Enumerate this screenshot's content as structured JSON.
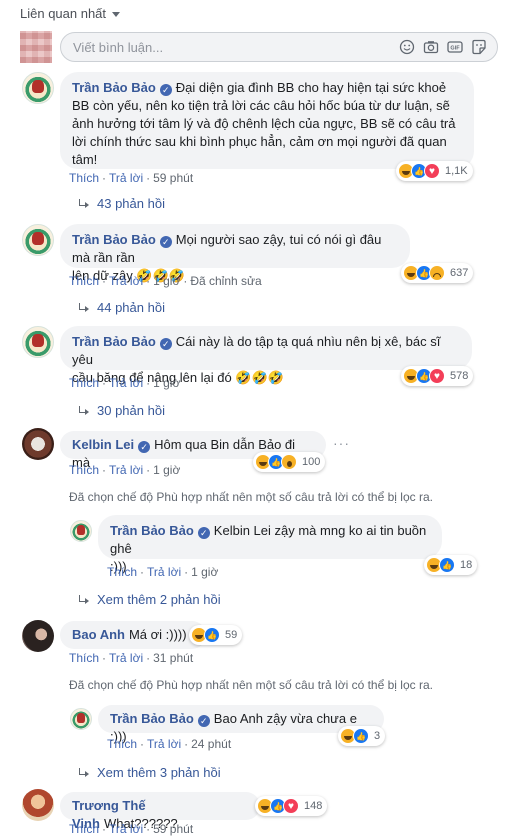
{
  "sort": {
    "label": "Liên quan nhất"
  },
  "composer": {
    "placeholder": "Viết bình luận..."
  },
  "actions": {
    "like": "Thích",
    "reply": "Trả lời",
    "separator": "·"
  },
  "filtered_note": "Đã chọn chế độ Phù hợp nhất nên một số câu trả lời có thể bị lọc ra.",
  "comments": [
    {
      "name": "Trần Bảo Bảo",
      "verified": true,
      "text_lines": [
        "Đại diện gia đình BB cho hay hiện tại sức khoẻ",
        "BB còn yếu, nên ko tiện trả lời các câu hỏi hốc búa từ dư luận, sẽ",
        "ảnh hưởng tới tâm lý và độ chênh lệch của ngực, BB sẽ có câu trả",
        "lời chính thức sau khi bình phục hẳn, cảm ơn mọi người đã quan",
        "tâm!"
      ],
      "reactions": [
        "haha",
        "like",
        "love"
      ],
      "reaction_count": "1,1K",
      "time": "59 phút",
      "replies_label": "43 phản hồi"
    },
    {
      "name": "Trần Bảo Bảo",
      "verified": true,
      "text_lines": [
        "Mọi người sao zậy, tui có nói gì đâu mà rần rần",
        "lên dữ zậy 🤣🤣🤣"
      ],
      "reactions": [
        "haha",
        "like",
        "sad"
      ],
      "reaction_count": "637",
      "time": "1 giờ",
      "edited": "Đã chỉnh sửa",
      "replies_label": "44 phản hồi"
    },
    {
      "name": "Trần Bảo Bảo",
      "verified": true,
      "text_lines": [
        "Cái này là do tập tạ quá nhìu nên bị xê, bác sĩ yêu",
        "cầu băng để nâng lên lại đó 🤣🤣🤣"
      ],
      "reactions": [
        "haha",
        "like",
        "love"
      ],
      "reaction_count": "578",
      "time": "1 giờ",
      "replies_label": "30 phản hồi"
    },
    {
      "name": "Kelbin Lei",
      "verified": true,
      "text": "Hôm qua Bin dẫn Bảo đi mà",
      "reactions": [
        "haha",
        "like",
        "wow"
      ],
      "reaction_count": "100",
      "time": "1 giờ",
      "reply": {
        "name": "Trần Bảo Bảo",
        "verified": true,
        "text_lines": [
          "Kelbin Lei zậy mà mng ko ai tin buồn ghê",
          ":)))"
        ],
        "reactions": [
          "haha",
          "like"
        ],
        "reaction_count": "18",
        "time": "1 giờ"
      },
      "more_replies": "Xem thêm 2 phản hồi"
    },
    {
      "name": "Bao Anh",
      "verified": false,
      "text": "Má ơi :))))",
      "reactions": [
        "haha",
        "like"
      ],
      "reaction_count": "59",
      "time": "31 phút",
      "reply": {
        "name": "Trần Bảo Bảo",
        "verified": true,
        "text": "Bao Anh zậy vừa chưa e :)))",
        "reactions": [
          "haha",
          "like"
        ],
        "reaction_count": "3",
        "time": "24 phút"
      },
      "more_replies": "Xem thêm 3 phản hồi"
    },
    {
      "name": "Trương Thế Vinh",
      "verified": false,
      "text": "What??????",
      "reactions": [
        "haha",
        "like",
        "love"
      ],
      "reaction_count": "148",
      "time": "59 phút"
    }
  ]
}
